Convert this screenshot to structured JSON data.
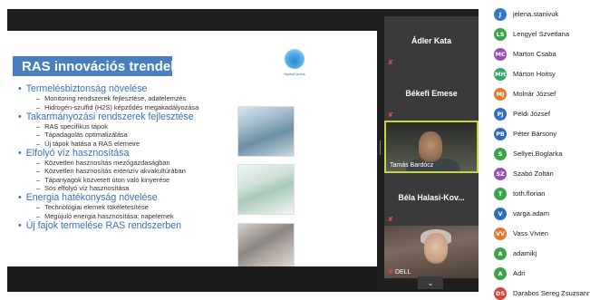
{
  "slide": {
    "title": "RAS innovációs trendek",
    "logo_text": "HydroCorvus",
    "bullets": [
      {
        "level": 1,
        "text": "Termelésbiztonság növelése"
      },
      {
        "level": 2,
        "text": "Monitoring rendszerek fejlesztése, adatelemzés"
      },
      {
        "level": 2,
        "text": "Hidrogén-szulfid (H2S) képződés megakadályozása"
      },
      {
        "level": 1,
        "text": "Takarmányozási rendszerek fejlesztése"
      },
      {
        "level": 2,
        "text": "RAS specifikus tápok"
      },
      {
        "level": 2,
        "text": "Tápadagolás optimalizálása"
      },
      {
        "level": 2,
        "text": "Új tápok hatása a RAS elemeire"
      },
      {
        "level": 1,
        "text": "Elfolyó víz hasznosítása"
      },
      {
        "level": 2,
        "text": "Közvetlen hasznosítás mezőgazdaságban"
      },
      {
        "level": 2,
        "text": "Közvetlen hasznosítás extenzív akvakultúrában"
      },
      {
        "level": 2,
        "text": "Tápanyagok közvetett úton való kinyerése"
      },
      {
        "level": 2,
        "text": "Sós elfolyó víz hasznosítása"
      },
      {
        "level": 1,
        "text": "Energia hatékonyság növelése"
      },
      {
        "level": 2,
        "text": "Technológiai elemek tökéletesítése"
      },
      {
        "level": 2,
        "text": "Megújuló energia hasznosítása: napelemek"
      },
      {
        "level": 1,
        "text": "Új fajok termelése RAS rendszerben"
      }
    ]
  },
  "tiles": {
    "adler": {
      "name": "Ádler Kata",
      "mic": "✘"
    },
    "bekefi": {
      "name": "Békefi Emese",
      "mic": "✘"
    },
    "bardocz": {
      "caption": "Tamás Bardócz"
    },
    "halasi": {
      "name": "Béla  Halasi-Kov...",
      "mic": "✘"
    },
    "dell": {
      "caption": "DELL",
      "mic": "✘"
    }
  },
  "collapse_icon": "⌄",
  "participants": [
    {
      "initials": "J",
      "name": "jelena.stanivuk",
      "color": "#3277c9"
    },
    {
      "initials": "LS",
      "name": "Lengyel Szvetlana",
      "color": "#3aa54a"
    },
    {
      "initials": "MC",
      "name": "Marton Csaba",
      "color": "#9a4fb5"
    },
    {
      "initials": "MH",
      "name": "Márton Hoitsy",
      "color": "#33a76a"
    },
    {
      "initials": "MJ",
      "name": "Molnár József",
      "color": "#e07b2d"
    },
    {
      "initials": "PJ",
      "name": "Peldi József",
      "color": "#2f6fc0"
    },
    {
      "initials": "PB",
      "name": "Péter Bársony",
      "color": "#2d6cc1"
    },
    {
      "initials": "S",
      "name": "Sellyei.Boglarka",
      "color": "#37a448"
    },
    {
      "initials": "SZ",
      "name": "Szabó Zoltán",
      "color": "#9552b3"
    },
    {
      "initials": "T",
      "name": "toth.florian",
      "color": "#3aa54a"
    },
    {
      "initials": "V",
      "name": "varga.adam",
      "color": "#2f6fc0"
    },
    {
      "initials": "VV",
      "name": "Vass Vivien",
      "color": "#e07b2d"
    },
    {
      "initials": "A",
      "name": "adamikj",
      "color": "#3aa54a"
    },
    {
      "initials": "A",
      "name": "Adri",
      "color": "#3aa54a"
    },
    {
      "initials": "DS",
      "name": "Darabos Sereg Zsuzsanna",
      "color": "#d8453f"
    }
  ]
}
